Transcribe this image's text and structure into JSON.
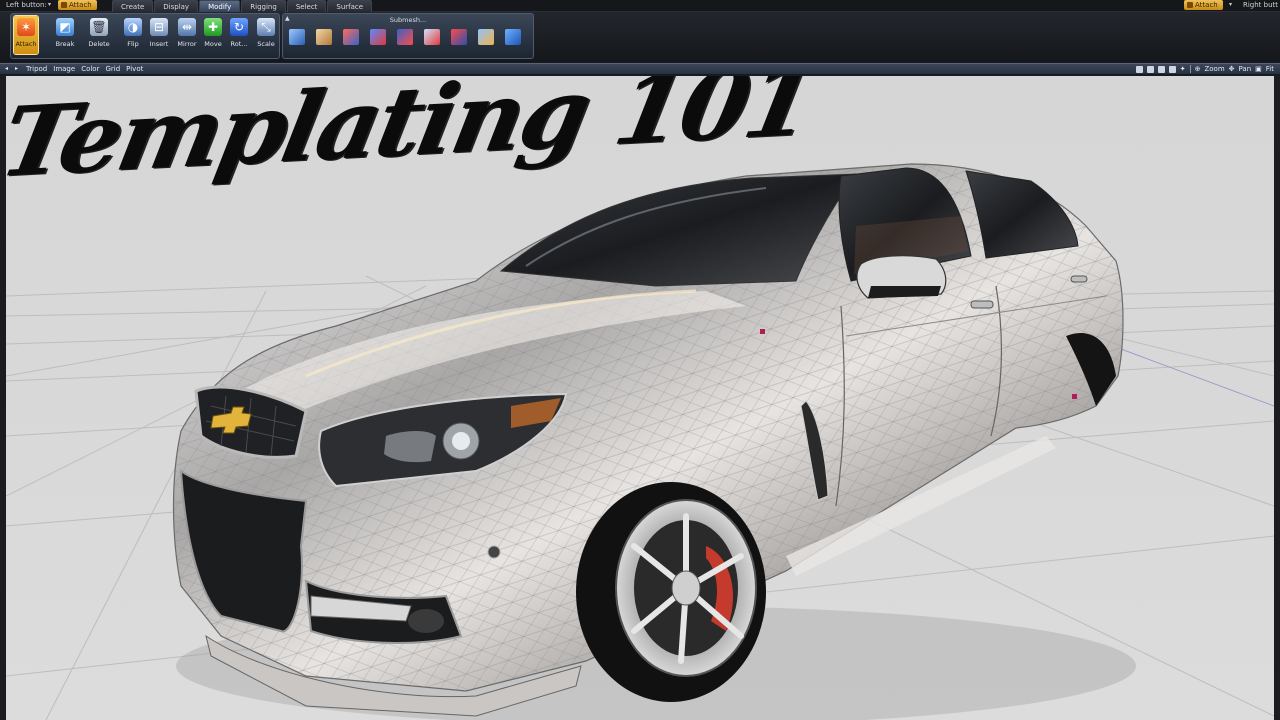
{
  "topbar": {
    "left_button_label": "Left button:",
    "left_mode": "Attach",
    "right_mode": "Attach",
    "right_button_label": "Right butt"
  },
  "tabs": [
    {
      "label": "Create"
    },
    {
      "label": "Display"
    },
    {
      "label": "Modify"
    },
    {
      "label": "Rigging"
    },
    {
      "label": "Select"
    },
    {
      "label": "Surface"
    }
  ],
  "active_tab": "Modify",
  "ribbon": {
    "tools": [
      {
        "label": "Attach",
        "icon": "attach-icon",
        "glyph": "✶"
      },
      {
        "label": "Break",
        "icon": "break-icon",
        "glyph": "◩"
      },
      {
        "label": "Delete",
        "icon": "delete-icon",
        "glyph": "🗑"
      },
      {
        "label": "Flip",
        "icon": "flip-icon",
        "glyph": "◑"
      },
      {
        "label": "Insert",
        "icon": "insert-icon",
        "glyph": "⊟"
      },
      {
        "label": "Mirror",
        "icon": "mirror-icon",
        "glyph": "⇹"
      },
      {
        "label": "Move",
        "icon": "move-icon",
        "glyph": "✚"
      },
      {
        "label": "Rot...",
        "icon": "rotate-icon",
        "glyph": "↻"
      },
      {
        "label": "Scale",
        "icon": "scale-icon",
        "glyph": "⤡"
      }
    ],
    "submesh_title": "Submesh..."
  },
  "viewport_toolbar": {
    "menu": [
      "Tripod",
      "Image",
      "Color",
      "Grid",
      "Pivot"
    ],
    "right": {
      "zoom": "Zoom",
      "pan": "Pan",
      "fit": "Fit"
    }
  },
  "viewport": {
    "headline": "Templating 101",
    "background_color": "#d8d8d8",
    "car_color": "#c9c9cc"
  }
}
